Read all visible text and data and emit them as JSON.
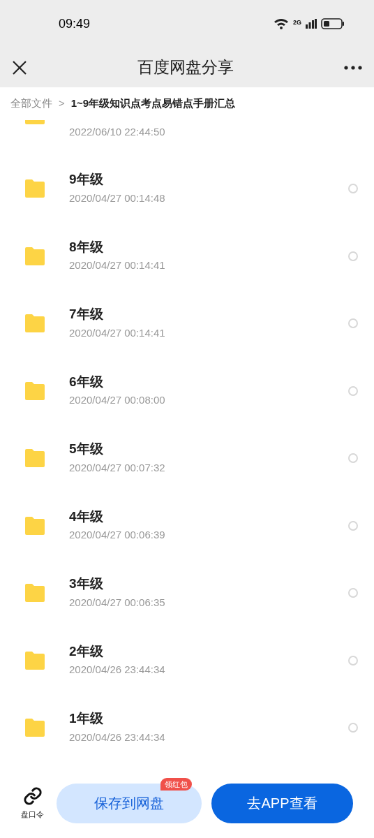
{
  "status_bar": {
    "time": "09:49",
    "network": "2G"
  },
  "header": {
    "title": "百度网盘分享"
  },
  "breadcrumb": [
    {
      "label": "全部文件",
      "current": false
    },
    {
      "label": "1~9年级知识点考点易错点手册汇总",
      "current": true
    }
  ],
  "breadcrumb_separator": ">",
  "partial_row": {
    "date": "2022/06/10 22:44:50"
  },
  "files": [
    {
      "name": "9年级",
      "date": "2020/04/27 00:14:48",
      "selected": false
    },
    {
      "name": "8年级",
      "date": "2020/04/27 00:14:41",
      "selected": false
    },
    {
      "name": "7年级",
      "date": "2020/04/27 00:14:41",
      "selected": false
    },
    {
      "name": "6年级",
      "date": "2020/04/27 00:08:00",
      "selected": false
    },
    {
      "name": "5年级",
      "date": "2020/04/27 00:07:32",
      "selected": false
    },
    {
      "name": "4年级",
      "date": "2020/04/27 00:06:39",
      "selected": false
    },
    {
      "name": "3年级",
      "date": "2020/04/27 00:06:35",
      "selected": false
    },
    {
      "name": "2年级",
      "date": "2020/04/26 23:44:34",
      "selected": false
    },
    {
      "name": "1年级",
      "date": "2020/04/26 23:44:34",
      "selected": false
    }
  ],
  "bottom_bar": {
    "link_label": "盘口令",
    "save_button": "保存到网盘",
    "save_badge": "领红包",
    "open_button": "去APP查看"
  }
}
